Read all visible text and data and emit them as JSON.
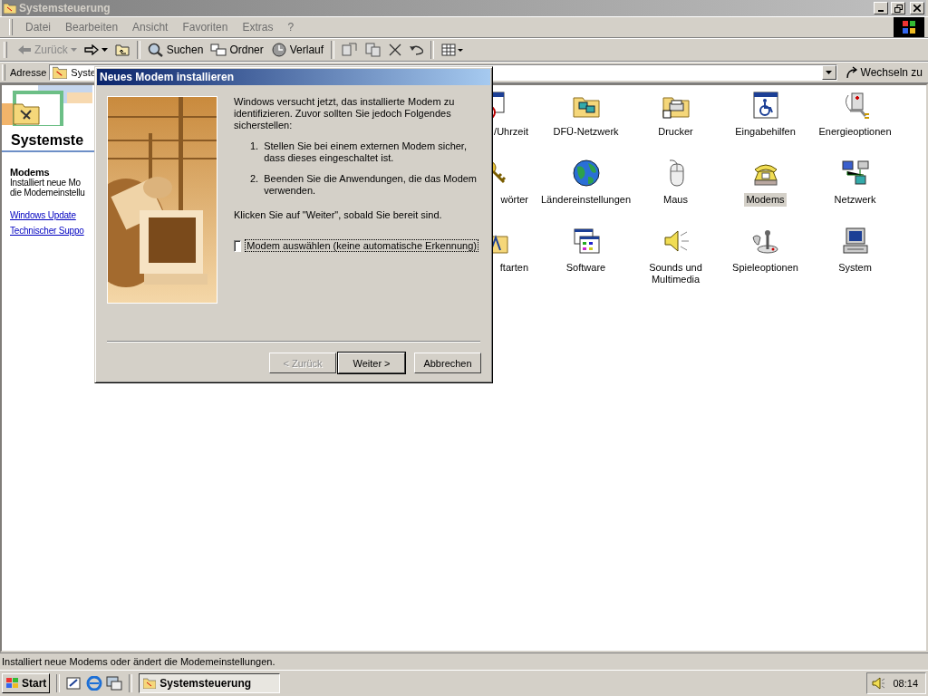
{
  "window": {
    "title": "Systemsteuerung"
  },
  "menu": [
    "Datei",
    "Bearbeiten",
    "Ansicht",
    "Favoriten",
    "Extras",
    "?"
  ],
  "toolbar": {
    "back": {
      "label": "Zurück",
      "disabled": true
    },
    "buttons": [
      "Suchen",
      "Ordner",
      "Verlauf"
    ]
  },
  "address": {
    "label": "Adresse",
    "value": "Syste",
    "go": "Wechseln zu"
  },
  "sidebar": {
    "heading": "Systemste",
    "item_title": "Modems",
    "description_lines": [
      "Installiert neue Mo",
      "die Modemeinstellu"
    ],
    "links": [
      "Windows Update",
      "Technischer Suppo"
    ]
  },
  "icons": [
    {
      "label": "/Uhrzeit",
      "selected": false
    },
    {
      "label": "DFÜ-Netzwerk",
      "selected": false
    },
    {
      "label": "Drucker",
      "selected": false
    },
    {
      "label": "Eingabehilfen",
      "selected": false
    },
    {
      "label": "Energieoptionen",
      "selected": false
    },
    {
      "label": "wörter",
      "selected": false
    },
    {
      "label": "Ländereinstellungen",
      "selected": false
    },
    {
      "label": "Maus",
      "selected": false
    },
    {
      "label": "Modems",
      "selected": true
    },
    {
      "label": "Netzwerk",
      "selected": false
    },
    {
      "label": "ftarten",
      "selected": false
    },
    {
      "label": "Software",
      "selected": false
    },
    {
      "label": "Sounds und Multimedia",
      "selected": false
    },
    {
      "label": "Spieleoptionen",
      "selected": false
    },
    {
      "label": "System",
      "selected": false
    }
  ],
  "dialog": {
    "title": "Neues Modem installieren",
    "intro": "Windows versucht jetzt, das installierte Modem zu identifizieren. Zuvor sollten Sie jedoch Folgendes sicherstellen:",
    "steps": [
      {
        "number": "1.",
        "text": "Stellen Sie bei einem externen Modem sicher, dass dieses eingeschaltet ist."
      },
      {
        "number": "2.",
        "text": "Beenden Sie die Anwendungen, die das Modem verwenden."
      }
    ],
    "closing": "Klicken Sie auf \"Weiter\", sobald Sie bereit sind.",
    "checkbox": {
      "label": "Modem auswählen (keine automatische Erkennung)",
      "checked": false
    },
    "buttons": [
      {
        "label": "< Zurück",
        "disabled": true,
        "default": false
      },
      {
        "label": "Weiter >",
        "disabled": false,
        "default": true
      },
      {
        "label": "Abbrechen",
        "disabled": false,
        "default": false
      }
    ]
  },
  "status_bar": "Installiert neue Modems oder ändert die Modemeinstellungen.",
  "taskbar": {
    "start": "Start",
    "tasks": [
      {
        "label": "Systemsteuerung",
        "selected": true
      }
    ],
    "clock": "08:14"
  }
}
